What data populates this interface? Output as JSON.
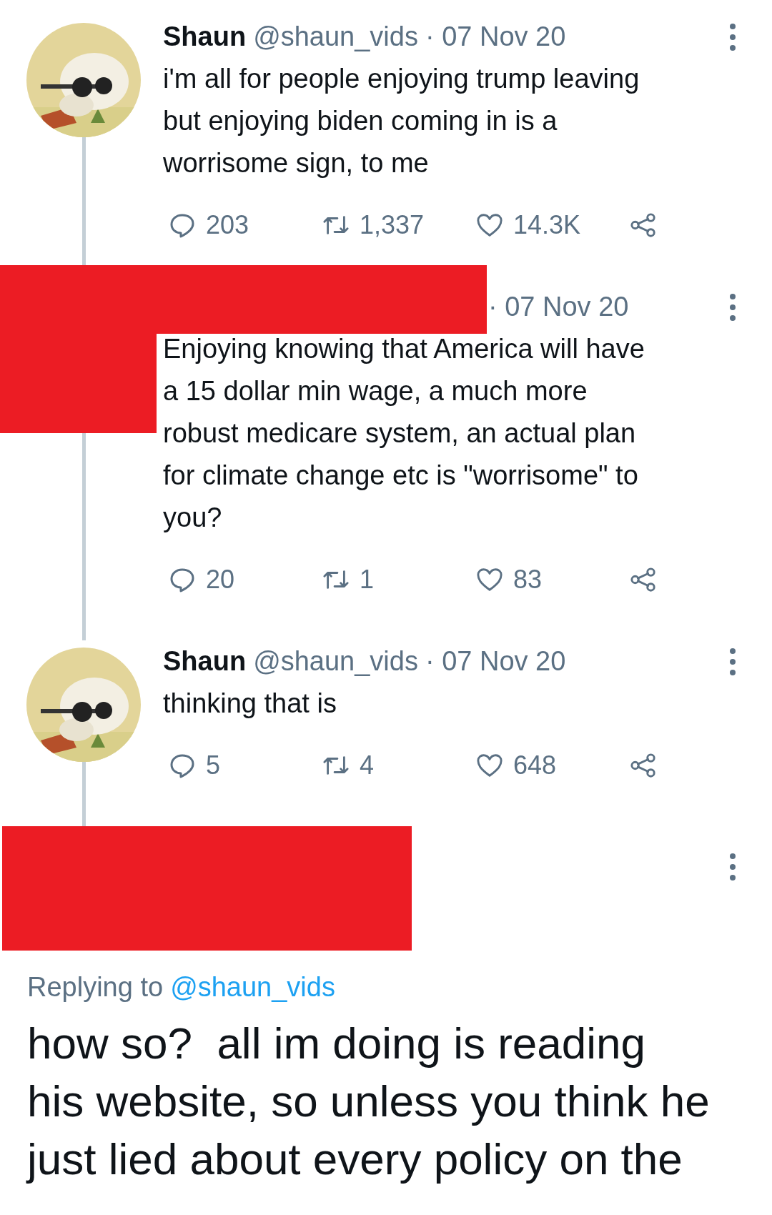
{
  "tweets": [
    {
      "kind": "normal",
      "name": "Shaun",
      "handle": "@shaun_vids",
      "date": "· 07 Nov 20",
      "lines": [
        "i'm all for people enjoying trump leaving",
        "but enjoying biden coming in is a",
        "worrisome sign, to me"
      ],
      "replies": "203",
      "retweets": "1,337",
      "likes": "14.3K"
    },
    {
      "kind": "redacted",
      "date": "· 07 Nov 20",
      "lines": [
        "Enjoying knowing that America will have",
        "a 15 dollar min wage, a much more",
        "robust medicare system, an actual plan",
        "for climate change etc is \"worrisome\" to",
        "you?"
      ],
      "replies": "20",
      "retweets": "1",
      "likes": "83"
    },
    {
      "kind": "normal",
      "name": "Shaun",
      "handle": "@shaun_vids",
      "date": "· 07 Nov 20",
      "lines": [
        "thinking that is"
      ],
      "replies": "5",
      "retweets": "4",
      "likes": "648"
    }
  ],
  "reply": {
    "kind": "redacted",
    "replying_label": "Replying to",
    "replying_handle": "@shaun_vids",
    "lines": [
      "how so?  all im doing is reading",
      "his website, so unless you think he",
      "just lied about every policy on the"
    ]
  }
}
